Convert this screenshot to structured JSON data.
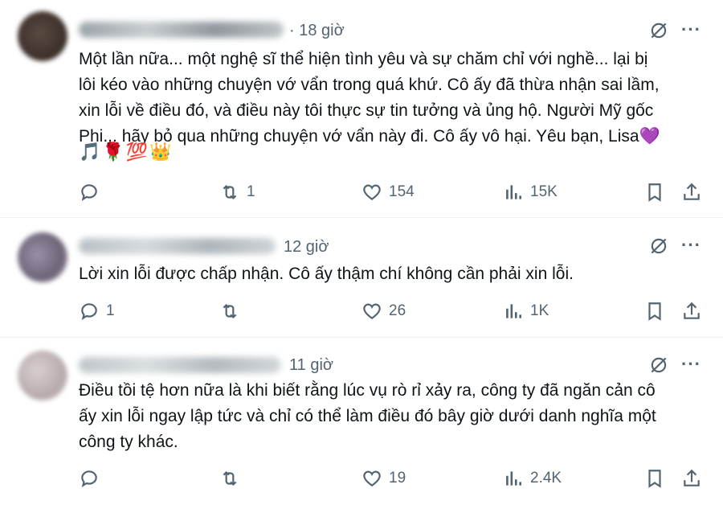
{
  "posts": [
    {
      "time": "· 18 giờ",
      "text": "Một lần nữa... một nghệ sĩ thể hiện tình yêu và sự chăm chỉ với nghề... lại bị\nlôi kéo vào những chuyện vớ vẩn trong quá khứ. Cô ấy đã thừa nhận sai lầm,\nxin lỗi về điều đó, và điều này tôi thực sự tin tưởng và ủng hộ. Người Mỹ gốc\nPhi... hãy bỏ qua những chuyện vớ vẩn này đi. Cô ấy vô hại. Yêu bạn, Lisa💜",
      "emojis": "🎵🌹💯👑",
      "replies": "",
      "reposts": "1",
      "likes": "154",
      "views": "15K"
    },
    {
      "time": "12 giờ",
      "text": "Lời xin lỗi được chấp nhận. Cô ấy thậm chí không cần phải xin lỗi.",
      "emojis": "",
      "replies": "1",
      "reposts": "",
      "likes": "26",
      "views": "1K"
    },
    {
      "time": "11 giờ",
      "text": "Điều tồi tệ hơn nữa là khi biết rằng lúc vụ rò rỉ xảy ra, công ty đã ngăn cản cô\nấy xin lỗi ngay lập tức và chỉ có thể làm điều đó bây giờ dưới danh nghĩa một\ncông ty khác.",
      "emojis": "",
      "replies": "",
      "reposts": "",
      "likes": "19",
      "views": "2.4K"
    }
  ],
  "icons": {
    "grok": "grok-icon",
    "more": "···",
    "reply": "reply-icon",
    "repost": "repost-icon",
    "like": "like-icon",
    "views": "views-icon",
    "bookmark": "bookmark-icon",
    "share": "share-icon"
  },
  "colors": {
    "text": "#0f1419",
    "muted": "#536471",
    "divider": "#eff3f4"
  }
}
